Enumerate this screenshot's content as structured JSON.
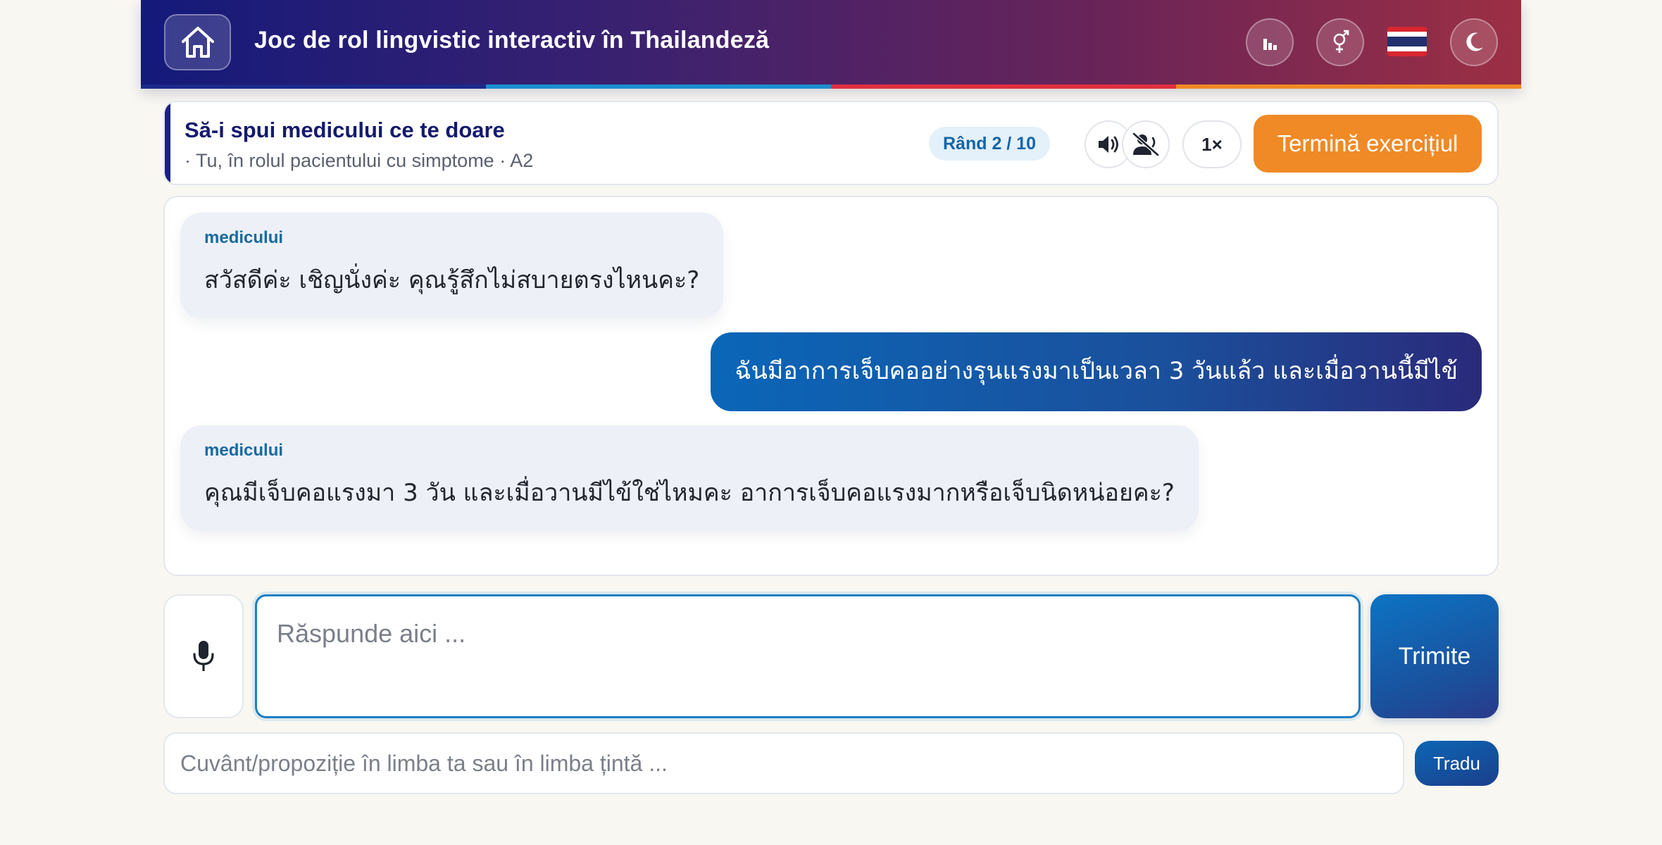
{
  "header": {
    "title": "Joc de rol lingvistic interactiv în Thailandeză",
    "icons": [
      "home-icon",
      "bar-chart-icon",
      "gender-icon",
      "thai-flag-icon",
      "moon-icon"
    ],
    "stripe_colors": [
      "#1b2a8a",
      "#1a8fd0",
      "#e0303f",
      "#f08a24"
    ]
  },
  "scenario": {
    "title": "Să-i spui medicului ce te doare",
    "subtitle": "· Tu, în rolul pacientului cu simptome · A2",
    "round": "Rând 2 / 10",
    "speed": "1×",
    "finish_label": "Termină exercițiul"
  },
  "chat": {
    "messages": [
      {
        "speaker": "medicului",
        "text": "สวัสดีค่ะ เชิญนั่งค่ะ คุณรู้สึกไม่สบายตรงไหนคะ?"
      },
      {
        "speaker": "",
        "text": "ฉันมีอาการเจ็บคออย่างรุนแรงมาเป็นเวลา 3 วันแล้ว และเมื่อวานนี้มีไข้"
      },
      {
        "speaker": "medicului",
        "text": "คุณมีเจ็บคอแรงมา 3 วัน และเมื่อวานมีไข้ใช่ไหมคะ อาการเจ็บคอแรงมากหรือเจ็บนิดหน่อยคะ?"
      }
    ]
  },
  "input": {
    "answer_placeholder": "Răspunde aici ...",
    "send_label": "Trimite",
    "translate_placeholder": "Cuvânt/propoziție în limba ta sau în limba țintă ...",
    "translate_label": "Tradu"
  },
  "colors": {
    "accent": "#1c7fc4",
    "finish": "#ef8a26",
    "header_start": "#141a7a",
    "header_end": "#9c2f44"
  }
}
